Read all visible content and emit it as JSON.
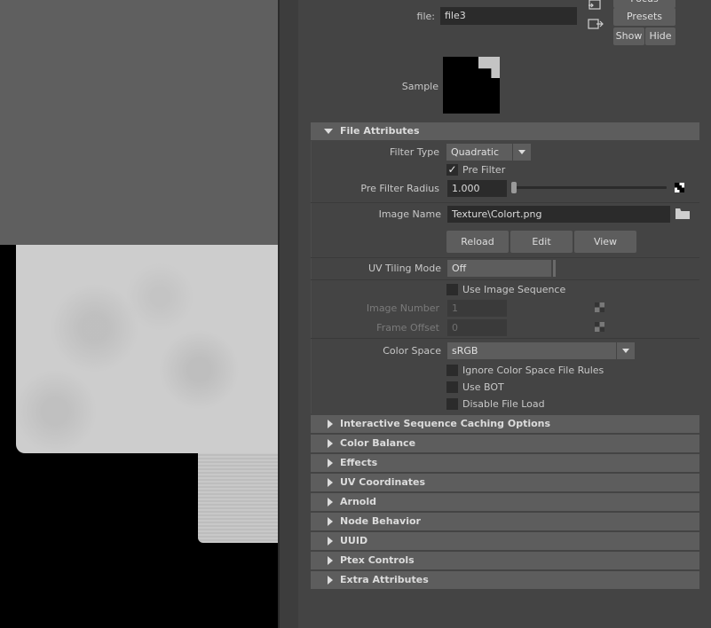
{
  "header": {
    "file_label": "file:",
    "file_value": "file3",
    "focus_button": "Focus",
    "presets_button": "Presets",
    "show_button": "Show",
    "hide_button": "Hide",
    "sample_label": "Sample"
  },
  "file_attributes": {
    "title": "File Attributes",
    "filter_type_label": "Filter Type",
    "filter_type_value": "Quadratic",
    "pre_filter_label": "Pre Filter",
    "pre_filter_checked": true,
    "pre_filter_radius_label": "Pre Filter Radius",
    "pre_filter_radius_value": "1.000",
    "image_name_label": "Image Name",
    "image_name_value": "Texture\\Colort.png",
    "reload_button": "Reload",
    "edit_button": "Edit",
    "view_button": "View",
    "uv_tiling_label": "UV Tiling Mode",
    "uv_tiling_value": "Off",
    "use_image_sequence_label": "Use Image Sequence",
    "image_number_label": "Image Number",
    "image_number_value": "1",
    "frame_offset_label": "Frame Offset",
    "frame_offset_value": "0",
    "color_space_label": "Color Space",
    "color_space_value": "sRGB",
    "ignore_cs_rules_label": "Ignore Color Space File Rules",
    "use_bot_label": "Use BOT",
    "disable_file_load_label": "Disable File Load"
  },
  "sections": [
    "Interactive Sequence Caching Options",
    "Color Balance",
    "Effects",
    "UV Coordinates",
    "Arnold",
    "Node Behavior",
    "UUID",
    "Ptex Controls",
    "Extra Attributes"
  ],
  "colors": {
    "panel_bg": "#444444",
    "section_bg": "#5d5d5d",
    "field_bg": "#2b2b2b",
    "viewport_bg": "#5f5f5f"
  }
}
